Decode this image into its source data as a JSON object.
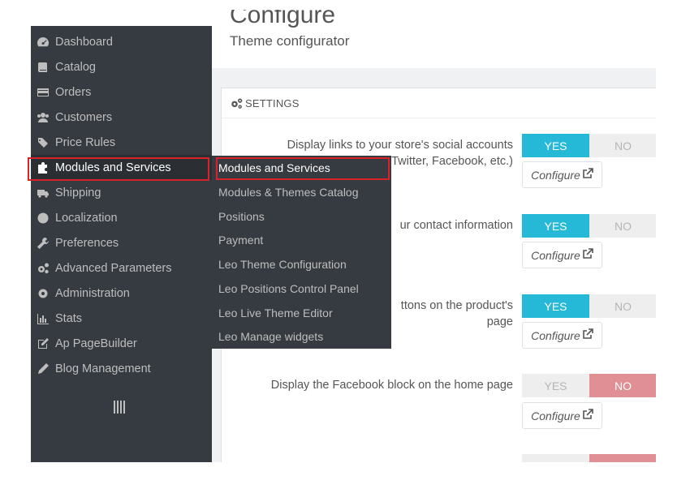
{
  "header": {
    "title": "Configure",
    "subtitle": "Theme configurator"
  },
  "sidebar": {
    "items": [
      {
        "label": "Dashboard",
        "icon": "dashboard-icon"
      },
      {
        "label": "Catalog",
        "icon": "book-icon"
      },
      {
        "label": "Orders",
        "icon": "credit-card-icon"
      },
      {
        "label": "Customers",
        "icon": "users-icon"
      },
      {
        "label": "Price Rules",
        "icon": "tags-icon"
      },
      {
        "label": "Modules and Services",
        "icon": "puzzle-icon",
        "active": true
      },
      {
        "label": "Shipping",
        "icon": "truck-icon"
      },
      {
        "label": "Localization",
        "icon": "globe-icon"
      },
      {
        "label": "Preferences",
        "icon": "wrench-icon"
      },
      {
        "label": "Advanced Parameters",
        "icon": "cogs-icon"
      },
      {
        "label": "Administration",
        "icon": "cog-icon"
      },
      {
        "label": "Stats",
        "icon": "bar-chart-icon"
      },
      {
        "label": "Ap PageBuilder",
        "icon": "edit-icon"
      },
      {
        "label": "Blog Management",
        "icon": "pencil-icon"
      }
    ]
  },
  "submenu": {
    "items": [
      {
        "label": "Modules and Services",
        "active": true
      },
      {
        "label": "Modules & Themes Catalog"
      },
      {
        "label": "Positions"
      },
      {
        "label": "Payment"
      },
      {
        "label": "Leo Theme Configuration"
      },
      {
        "label": "Leo Positions Control Panel"
      },
      {
        "label": "Leo Live Theme Editor"
      },
      {
        "label": "Leo Manage widgets"
      }
    ]
  },
  "settings": {
    "title": "SETTINGS",
    "yes_label": "YES",
    "no_label": "NO",
    "configure_label": "Configure",
    "rows": [
      {
        "label_line1": "Display links to your store's social accounts",
        "label_line2": "Twitter, Facebook, etc.)",
        "value": "YES"
      },
      {
        "label_line1": "ur contact information",
        "label_line2": "",
        "value": "YES"
      },
      {
        "label_line1": "ttons on the product's",
        "label_line2": "page",
        "value": "YES"
      },
      {
        "label_line1": "Display the Facebook block on the home page",
        "label_line2": "",
        "value": "NO"
      }
    ]
  },
  "colors": {
    "sidebar_bg": "#363a41",
    "yes_active": "#25b9d7",
    "no_active": "#e08f95",
    "highlight": "#d9232a"
  }
}
